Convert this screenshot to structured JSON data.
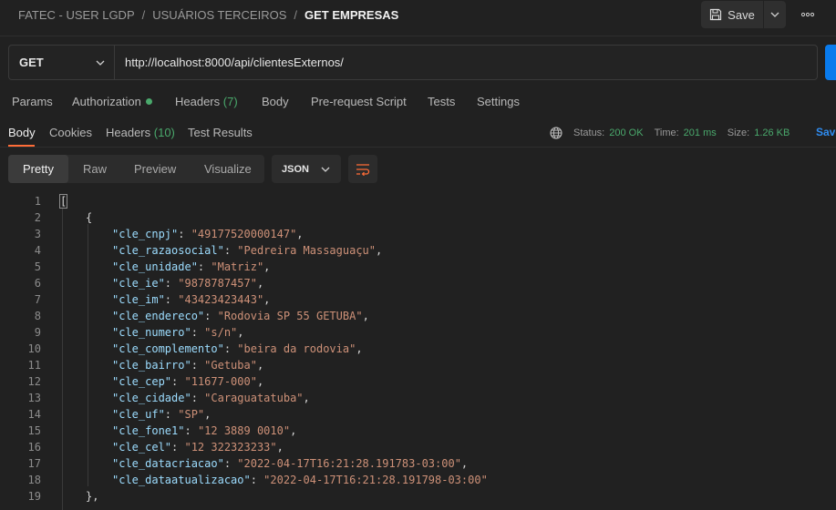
{
  "header": {
    "breadcrumb": [
      "FATEC - USER LGDP",
      "USUÁRIOS TERCEIROS",
      "GET EMPRESAS"
    ],
    "separator": "/",
    "save_label": "Save"
  },
  "request": {
    "method": "GET",
    "url": "http://localhost:8000/api/clientesExternos/"
  },
  "request_tabs": {
    "params": "Params",
    "authorization": "Authorization",
    "headers": "Headers",
    "headers_count": "(7)",
    "body": "Body",
    "prerequest": "Pre-request Script",
    "tests": "Tests",
    "settings": "Settings"
  },
  "response_tabs": {
    "body": "Body",
    "cookies": "Cookies",
    "headers": "Headers",
    "headers_count": "(10)",
    "test_results": "Test Results"
  },
  "response_status": {
    "status_label": "Status:",
    "status_value": "200 OK",
    "time_label": "Time:",
    "time_value": "201 ms",
    "size_label": "Size:",
    "size_value": "1.26 KB",
    "save_label": "Save"
  },
  "view_modes": [
    "Pretty",
    "Raw",
    "Preview",
    "Visualize"
  ],
  "format": "JSON",
  "code_lines": [
    {
      "n": "1",
      "indent": 0,
      "punct": "["
    },
    {
      "n": "2",
      "indent": 1,
      "punct": "{"
    },
    {
      "n": "3",
      "indent": 2,
      "key": "\"cle_cnpj\"",
      "value": "\"49177520000147\"",
      "comma": ","
    },
    {
      "n": "4",
      "indent": 2,
      "key": "\"cle_razaosocial\"",
      "value": "\"Pedreira Massaguaçu\"",
      "comma": ","
    },
    {
      "n": "5",
      "indent": 2,
      "key": "\"cle_unidade\"",
      "value": "\"Matriz\"",
      "comma": ","
    },
    {
      "n": "6",
      "indent": 2,
      "key": "\"cle_ie\"",
      "value": "\"9878787457\"",
      "comma": ","
    },
    {
      "n": "7",
      "indent": 2,
      "key": "\"cle_im\"",
      "value": "\"43423423443\"",
      "comma": ","
    },
    {
      "n": "8",
      "indent": 2,
      "key": "\"cle_endereco\"",
      "value": "\"Rodovia SP 55 GETUBA\"",
      "comma": ","
    },
    {
      "n": "9",
      "indent": 2,
      "key": "\"cle_numero\"",
      "value": "\"s/n\"",
      "comma": ","
    },
    {
      "n": "10",
      "indent": 2,
      "key": "\"cle_complemento\"",
      "value": "\"beira da rodovia\"",
      "comma": ","
    },
    {
      "n": "11",
      "indent": 2,
      "key": "\"cle_bairro\"",
      "value": "\"Getuba\"",
      "comma": ","
    },
    {
      "n": "12",
      "indent": 2,
      "key": "\"cle_cep\"",
      "value": "\"11677-000\"",
      "comma": ","
    },
    {
      "n": "13",
      "indent": 2,
      "key": "\"cle_cidade\"",
      "value": "\"Caraguatatuba\"",
      "comma": ","
    },
    {
      "n": "14",
      "indent": 2,
      "key": "\"cle_uf\"",
      "value": "\"SP\"",
      "comma": ","
    },
    {
      "n": "15",
      "indent": 2,
      "key": "\"cle_fone1\"",
      "value": "\"12 3889 0010\"",
      "comma": ","
    },
    {
      "n": "16",
      "indent": 2,
      "key": "\"cle_cel\"",
      "value": "\"12 322323233\"",
      "comma": ","
    },
    {
      "n": "17",
      "indent": 2,
      "key": "\"cle_datacriacao\"",
      "value": "\"2022-04-17T16:21:28.191783-03:00\"",
      "comma": ","
    },
    {
      "n": "18",
      "indent": 2,
      "key": "\"cle_dataatualizacao\"",
      "value": "\"2022-04-17T16:21:28.191798-03:00\"",
      "comma": ""
    },
    {
      "n": "19",
      "indent": 1,
      "punct": "},"
    }
  ],
  "colors": {
    "background": "#212121",
    "accent": "#ff6c37",
    "send": "#097bed",
    "status_ok": "#4aa96c",
    "json_key": "#9cdcfe",
    "json_string": "#ce9178"
  },
  "icons": {
    "save": "floppy-disk-icon",
    "save_caret": "chevron-down-icon",
    "more": "more-horizontal-icon",
    "method_caret": "chevron-down-icon",
    "globe": "globe-icon",
    "format_caret": "chevron-down-icon",
    "wrap": "wrap-lines-icon"
  }
}
